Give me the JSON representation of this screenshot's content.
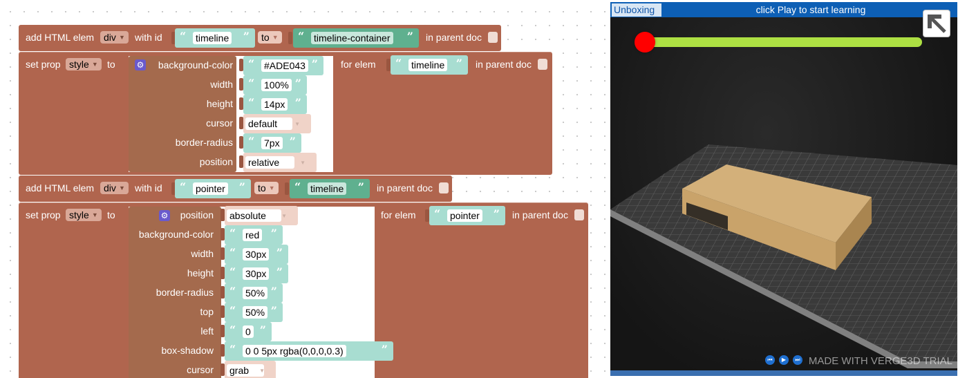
{
  "blocks": {
    "b1": {
      "label": "add HTML elem",
      "tag": "div",
      "with_id": "with id",
      "id_value": "timeline",
      "to_label": "to",
      "to_field": "to",
      "parent_value": "timeline-container",
      "in_parent": "in parent doc"
    },
    "b2": {
      "label": "set prop",
      "prop": "style",
      "to": "to",
      "rows": [
        {
          "name": "background-color",
          "value": "#ADE043",
          "kind": "text"
        },
        {
          "name": "width",
          "value": "100%",
          "kind": "text"
        },
        {
          "name": "height",
          "value": "14px",
          "kind": "text"
        },
        {
          "name": "cursor",
          "value": "default",
          "kind": "dropdown"
        },
        {
          "name": "border-radius",
          "value": "7px",
          "kind": "text"
        },
        {
          "name": "position",
          "value": "relative",
          "kind": "dropdown"
        }
      ],
      "for_elem": "for elem",
      "elem_value": "timeline",
      "in_parent": "in parent doc"
    },
    "b3": {
      "label": "add HTML elem",
      "tag": "div",
      "with_id": "with id",
      "id_value": "pointer",
      "to_field": "to",
      "parent_value": "timeline",
      "in_parent": "in parent doc"
    },
    "b4": {
      "label": "set prop",
      "prop": "style",
      "to": "to",
      "rows": [
        {
          "name": "position",
          "value": "absolute",
          "kind": "dropdown"
        },
        {
          "name": "background-color",
          "value": "red",
          "kind": "text"
        },
        {
          "name": "width",
          "value": "30px",
          "kind": "text"
        },
        {
          "name": "height",
          "value": "30px",
          "kind": "text"
        },
        {
          "name": "border-radius",
          "value": "50%",
          "kind": "text"
        },
        {
          "name": "top",
          "value": "50%",
          "kind": "text"
        },
        {
          "name": "left",
          "value": "0",
          "kind": "text"
        },
        {
          "name": "box-shadow",
          "value": "0 0 5px rgba(0,0,0,0.3)",
          "kind": "text"
        },
        {
          "name": "cursor",
          "value": "grab",
          "kind": "dropdown"
        }
      ],
      "for_elem": "for elem",
      "elem_value": "pointer",
      "in_parent": "in parent doc"
    }
  },
  "viewer": {
    "tab": "Unboxing",
    "hint": "click Play to start learning",
    "watermark": "MADE WITH VERGE3D TRIAL",
    "timeline_color": "#ADE043",
    "pointer_color": "red",
    "progress": 0,
    "fullscreen_icon": "fullscreen-icon",
    "buttons": [
      "rewind-icon",
      "play-icon",
      "forward-icon"
    ]
  },
  "glyphs": {
    "quote_open": "“",
    "quote_close": "”",
    "arrow": "▼",
    "gear": "⚙"
  }
}
